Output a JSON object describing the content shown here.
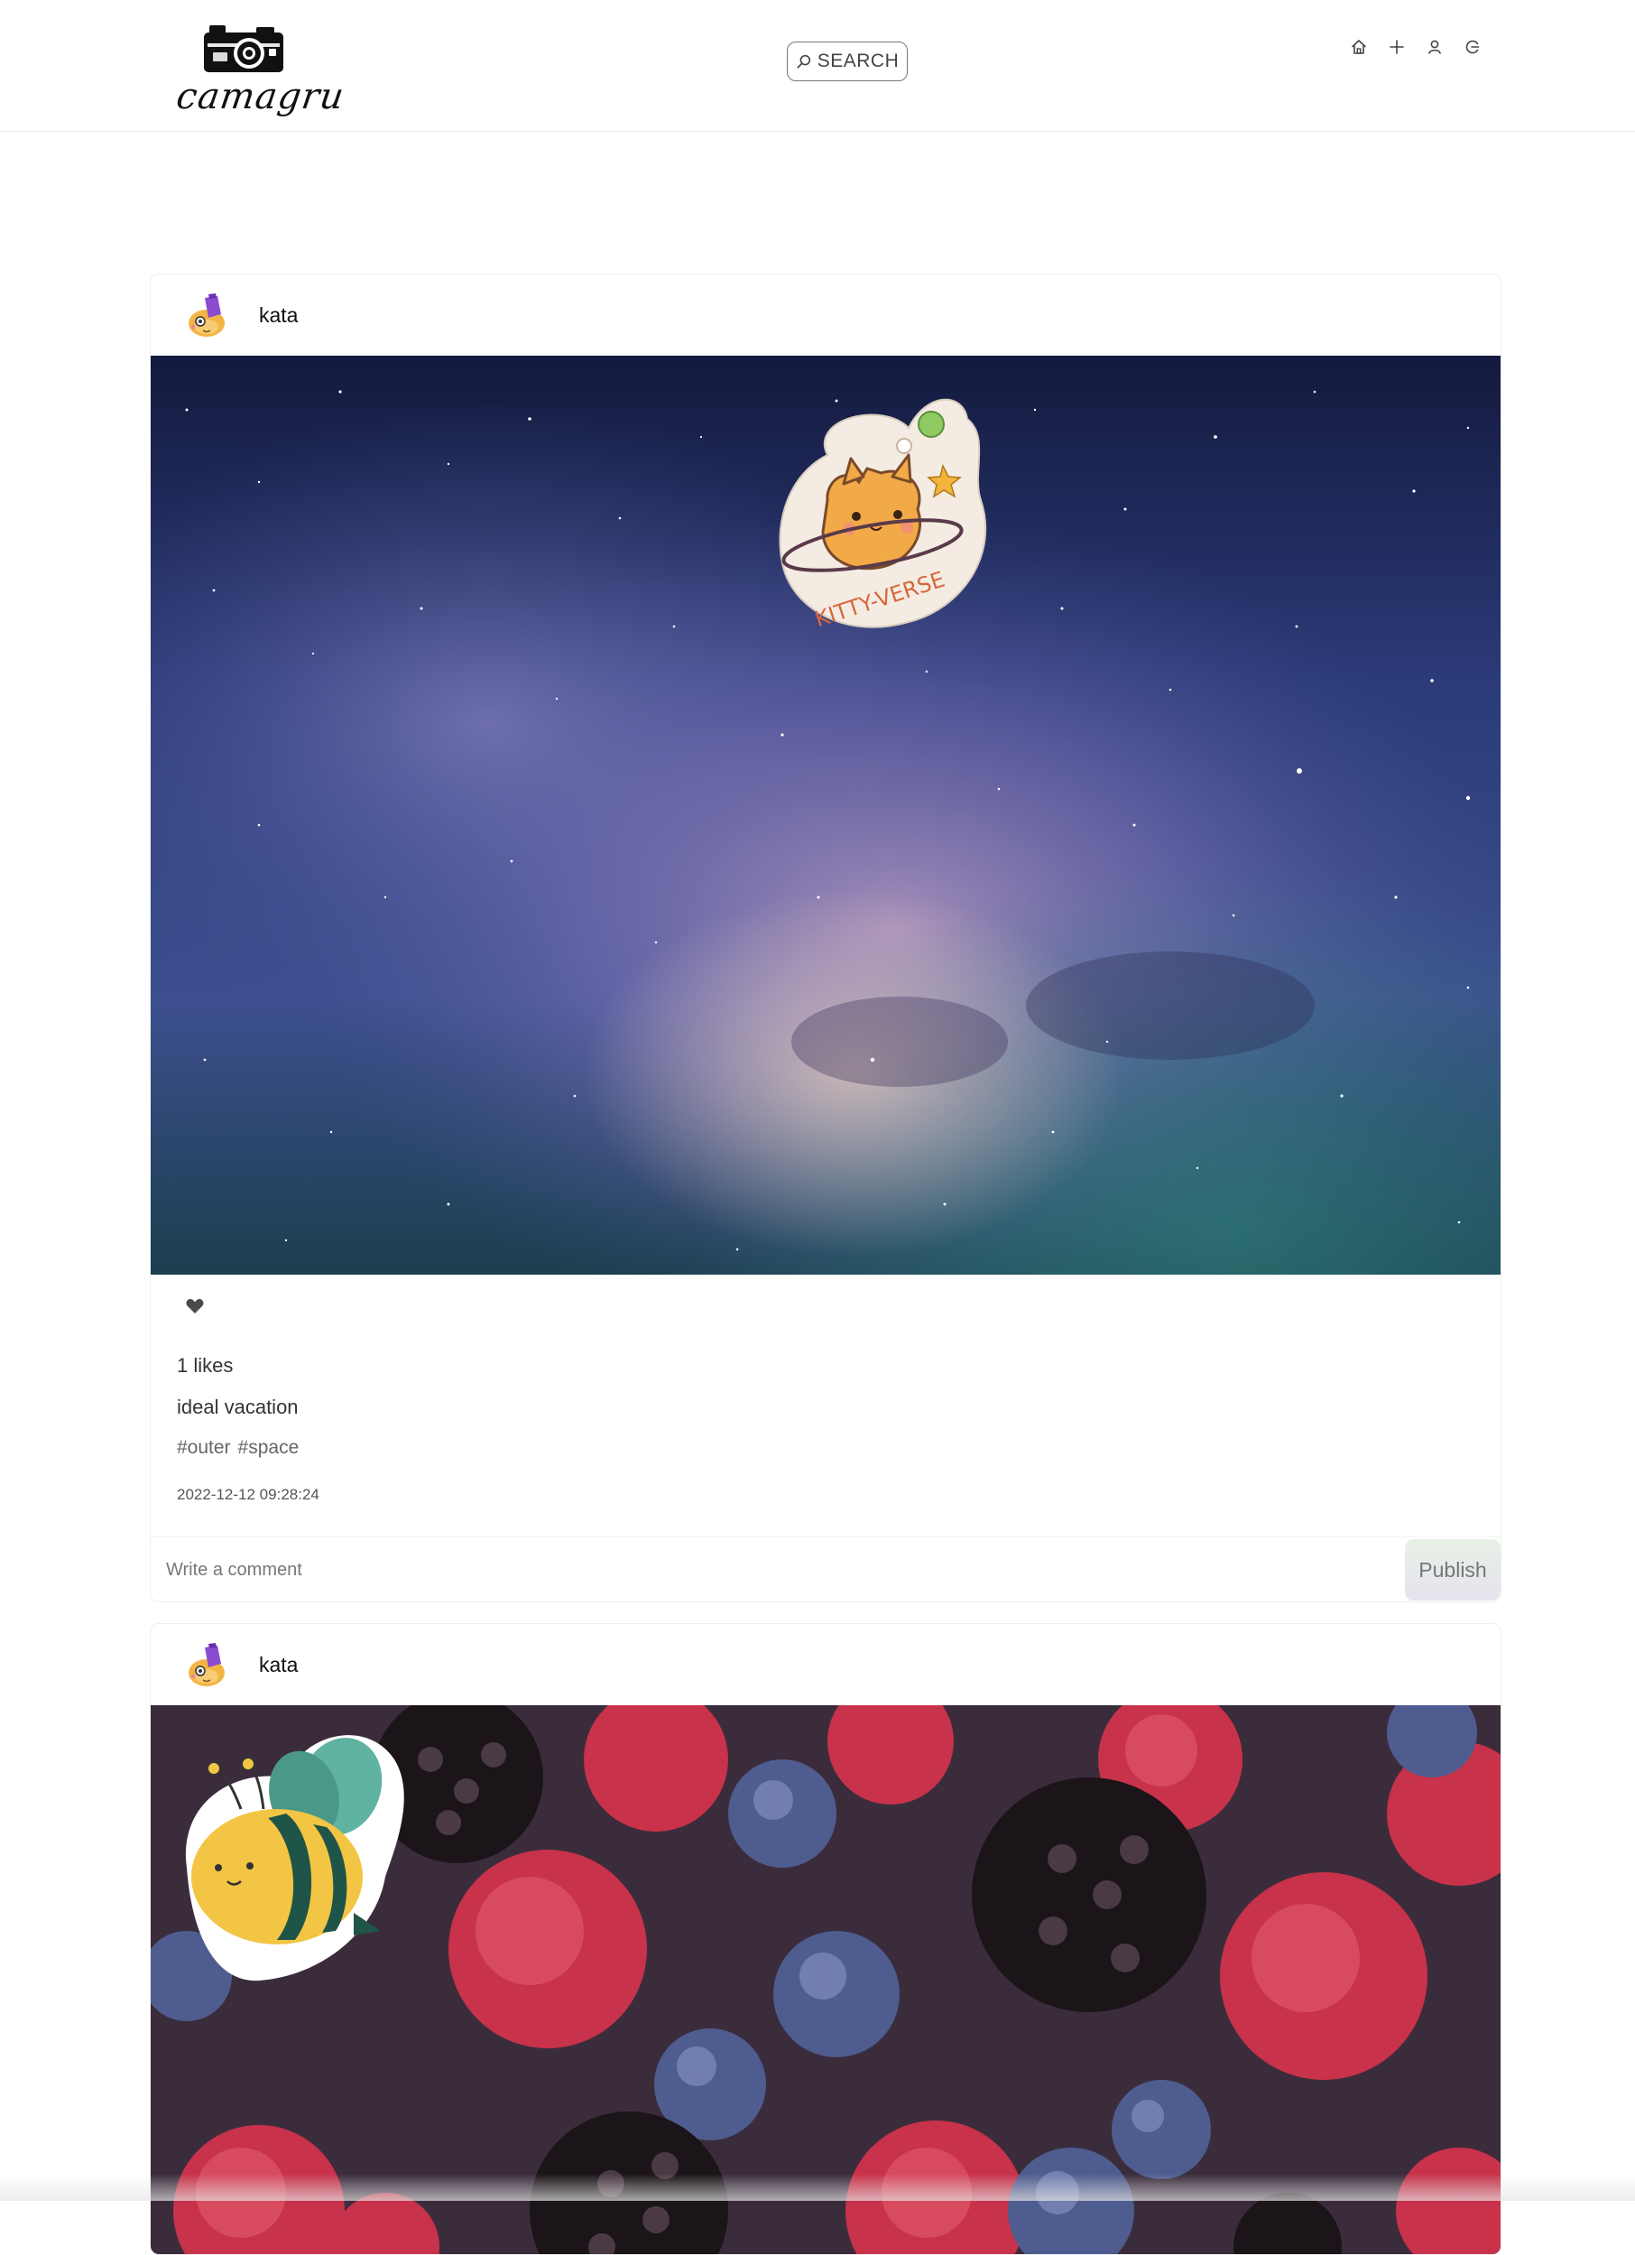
{
  "app": {
    "logo_text": "camagru"
  },
  "header": {
    "search_label": "SEARCH",
    "nav": [
      {
        "icon": "home-icon"
      },
      {
        "icon": "plus-icon"
      },
      {
        "icon": "user-icon"
      },
      {
        "icon": "logout-icon"
      }
    ]
  },
  "posts": [
    {
      "username": "kata",
      "image": "milky way night sky with kitty-verse sticker",
      "sticker_text": "KITTY-VERSE",
      "likes_text": "1 likes",
      "caption": "ideal vacation",
      "tags": [
        "#outer",
        "#space"
      ],
      "timestamp": "2022-12-12 09:28:24",
      "comment_placeholder": "Write a comment",
      "publish_label": "Publish"
    },
    {
      "username": "kata",
      "image": "mixed berries with bee sticker"
    }
  ],
  "colors": {
    "text": "#222222",
    "muted": "#666666",
    "border": "#efefef",
    "publish_bg_top": "#e7f1e6",
    "publish_bg_bottom": "#e6e3ef"
  }
}
